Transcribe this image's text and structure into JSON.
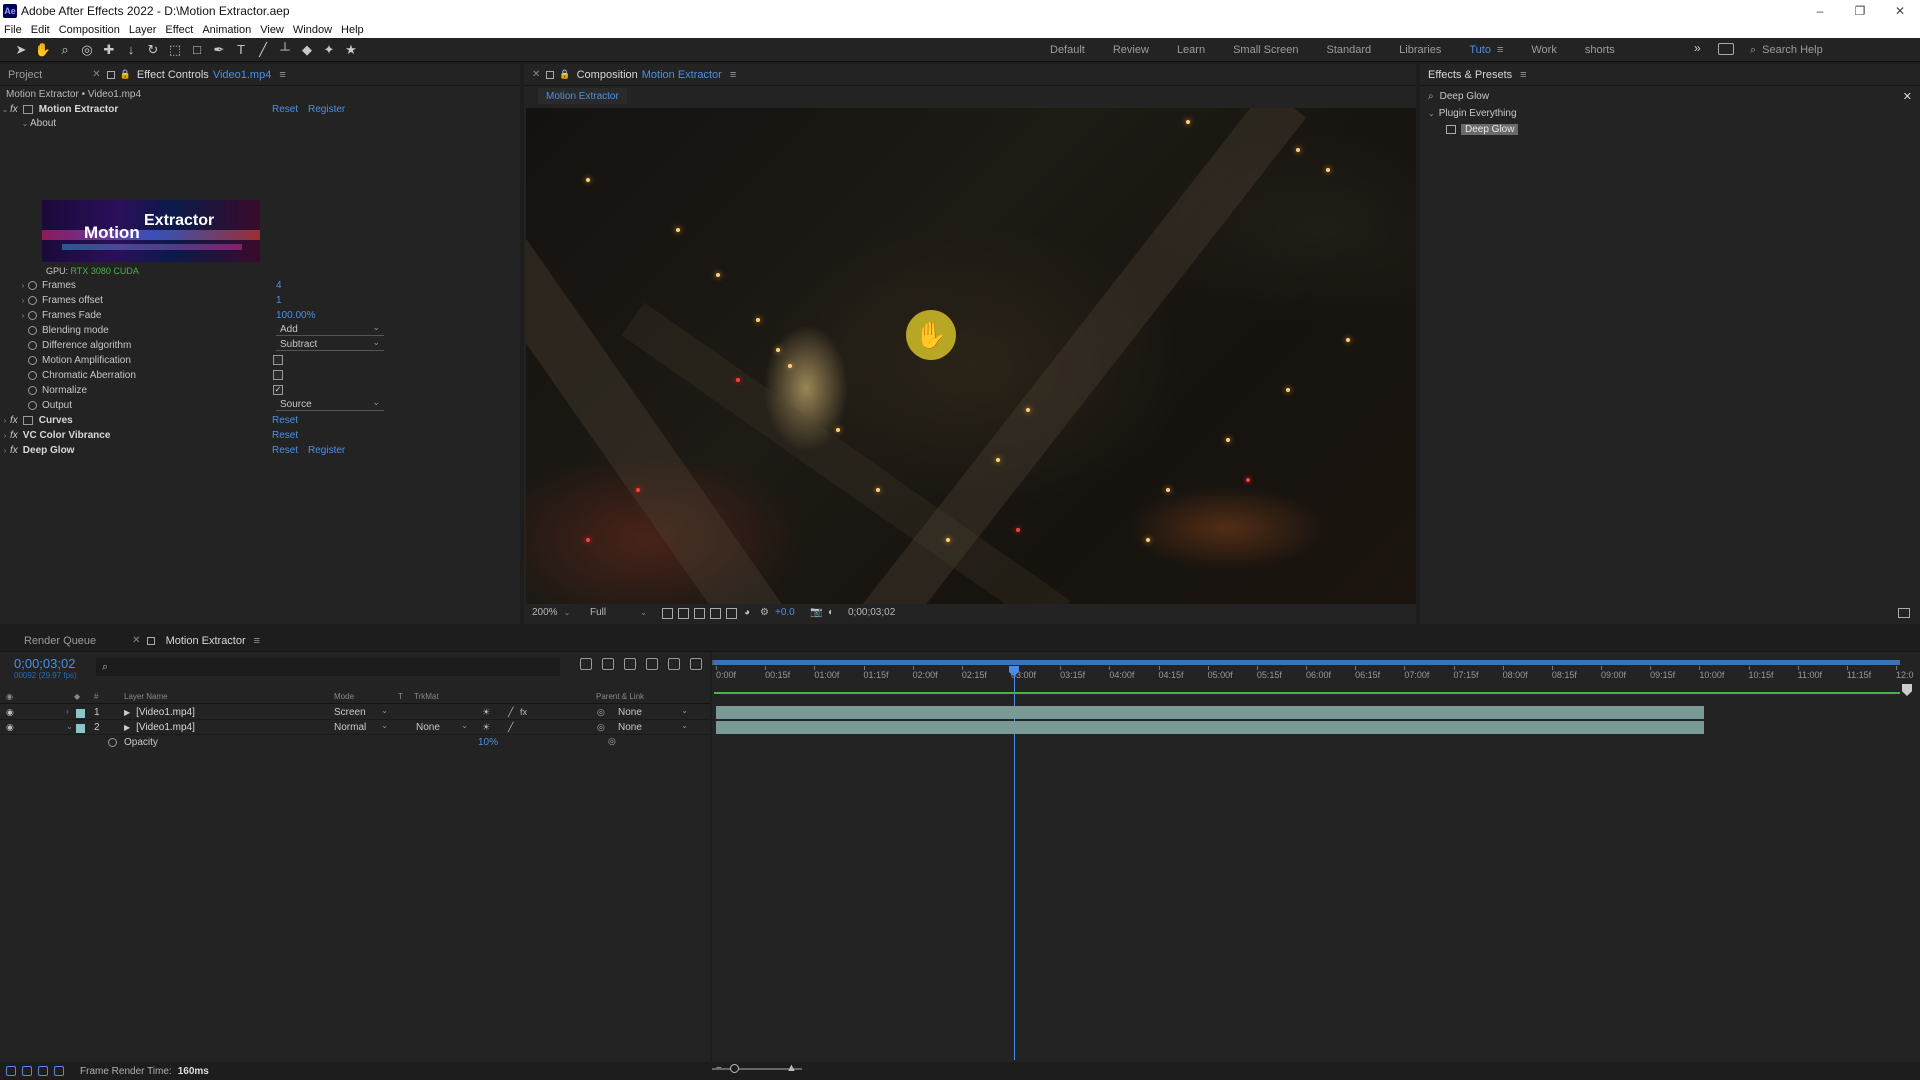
{
  "window": {
    "title": "Adobe After Effects 2022 - D:\\Motion Extractor.aep",
    "app_icon": "Ae",
    "minimize": "–",
    "restore": "❐",
    "close": "✕"
  },
  "menu": [
    "File",
    "Edit",
    "Composition",
    "Layer",
    "Effect",
    "Animation",
    "View",
    "Window",
    "Help"
  ],
  "workspaces": {
    "items": [
      "Default",
      "Review",
      "Learn",
      "Small Screen",
      "Standard",
      "Libraries",
      "Tuto",
      "Work",
      "shorts"
    ],
    "active": "Tuto",
    "more": "»"
  },
  "search_help": {
    "placeholder": "Search Help",
    "icon": "search-icon"
  },
  "effect_controls": {
    "tabs": {
      "project": "Project",
      "effect_controls": "Effect Controls",
      "layer": "Video1.mp4"
    },
    "subtitle": "Motion Extractor • Video1.mp4",
    "effect_name": "Motion Extractor",
    "reset": "Reset",
    "register": "Register",
    "about": "About",
    "image_text_1": "Motion",
    "image_text_2": "Extractor",
    "gpu_label": "GPU:",
    "gpu_value": "RTX 3080 CUDA",
    "params": [
      {
        "name": "Frames",
        "value": "4"
      },
      {
        "name": "Frames offset",
        "value": "1"
      },
      {
        "name": "Frames Fade",
        "value": "100.00%"
      },
      {
        "name": "Blending mode",
        "value": "Add"
      },
      {
        "name": "Difference algorithm",
        "value": "Subtract"
      },
      {
        "name": "Motion Amplification",
        "value": ""
      },
      {
        "name": "Chromatic Aberration",
        "value": ""
      },
      {
        "name": "Normalize",
        "value": "✓"
      },
      {
        "name": "Output",
        "value": "Source"
      }
    ],
    "other_effects": [
      {
        "name": "Curves",
        "reset": "Reset"
      },
      {
        "name": "VC Color Vibrance",
        "reset": "Reset"
      },
      {
        "name": "Deep Glow",
        "reset": "Reset",
        "register": "Register"
      }
    ]
  },
  "composition": {
    "tab_label": "Composition",
    "comp_name": "Motion Extractor",
    "breadcrumb": "Motion Extractor",
    "zoom": "200%",
    "resolution": "Full",
    "exposure": "+0.0",
    "timecode": "0;00;03;02"
  },
  "effects_presets": {
    "tab": "Effects & Presets",
    "search_value": "Deep Glow",
    "category": "Plugin Everything",
    "item": "Deep Glow"
  },
  "timeline": {
    "tabs": {
      "render_queue": "Render Queue",
      "comp": "Motion Extractor"
    },
    "timecode": "0;00;03;02",
    "timecode_sub": "00092 (29.97 fps)",
    "search_icon": "⌕",
    "columns": {
      "layer_name": "Layer Name",
      "mode": "Mode",
      "t": "T",
      "trkmat": "TrkMat",
      "parent": "Parent & Link",
      "hash": "#"
    },
    "layers": [
      {
        "num": "1",
        "name": "[Video1.mp4]",
        "mode": "Screen",
        "trkmat": "",
        "parent": "None",
        "twirl": "›"
      },
      {
        "num": "2",
        "name": "[Video1.mp4]",
        "mode": "Normal",
        "trkmat": "None",
        "parent": "None",
        "twirl": "⌄"
      }
    ],
    "opacity_label": "Opacity",
    "opacity_value": "10%",
    "ruler": [
      "0:00f",
      "00:15f",
      "01:00f",
      "01:15f",
      "02:00f",
      "02:15f",
      "03:00f",
      "03:15f",
      "04:00f",
      "04:15f",
      "05:00f",
      "05:15f",
      "06:00f",
      "06:15f",
      "07:00f",
      "07:15f",
      "08:00f",
      "08:15f",
      "09:00f",
      "09:15f",
      "10:00f",
      "10:15f",
      "11:00f",
      "11:15f",
      "12:0"
    ],
    "playhead_time_fraction": 0.2525
  },
  "status": {
    "label": "Frame Render Time:",
    "value": "160ms"
  },
  "colors": {
    "accent": "#4a90e2",
    "layer_swatch": "#8cc5c5",
    "track": "#7a9a95",
    "hand_cursor": "#d2be28"
  }
}
